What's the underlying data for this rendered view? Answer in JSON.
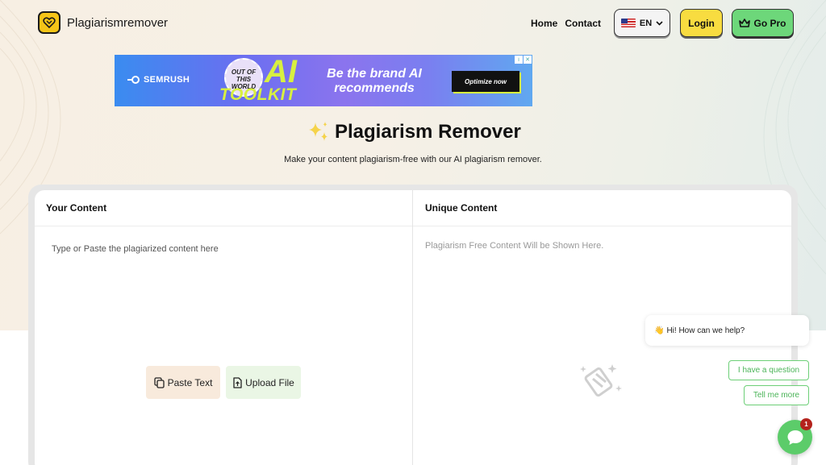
{
  "header": {
    "logo_text": "Plagiarismremover",
    "logo_icon": "heart-logo-icon",
    "nav": {
      "home": "Home",
      "contact": "Contact"
    },
    "language": {
      "flag_icon": "us-flag-icon",
      "label": "EN",
      "chevron_icon": "chevron-down-icon"
    },
    "login_label": "Login",
    "pro": {
      "icon": "crown-icon",
      "label": "Go Pro"
    }
  },
  "ad": {
    "brand": "SEMRUSH",
    "badge_text": "OUT OF THIS WORLD",
    "ai_text": "AI",
    "toolkit_text": "TOOLKIT",
    "headline": "Be the brand AI recommends",
    "cta": "Optimize now",
    "tag_info": "i",
    "tag_close": "✕"
  },
  "hero": {
    "sparkle_icon": "sparkle-icon",
    "title": "Plagiarism Remover",
    "subtitle": "Make your content plagiarism-free with our AI plagiarism remover."
  },
  "editor": {
    "input_heading": "Your Content",
    "input_placeholder": "Type or Paste the plagiarized content here",
    "paste_button": {
      "icon": "paste-icon",
      "label": "Paste Text"
    },
    "upload_button": {
      "icon": "file-upload-icon",
      "label": "Upload File"
    },
    "output_heading": "Unique Content",
    "output_placeholder": "Plagiarism Free Content Will be Shown Here."
  },
  "chat": {
    "greeting_emoji": "👋",
    "greeting": "Hi! How can we help?",
    "chips": [
      "I have a question",
      "Tell me more"
    ],
    "launcher_icon": "chat-bubble-icon",
    "badge_count": "1"
  },
  "colors": {
    "accent_yellow": "#f8dc40",
    "accent_green": "#6dd77a",
    "chat_green": "#5ccc6a"
  }
}
